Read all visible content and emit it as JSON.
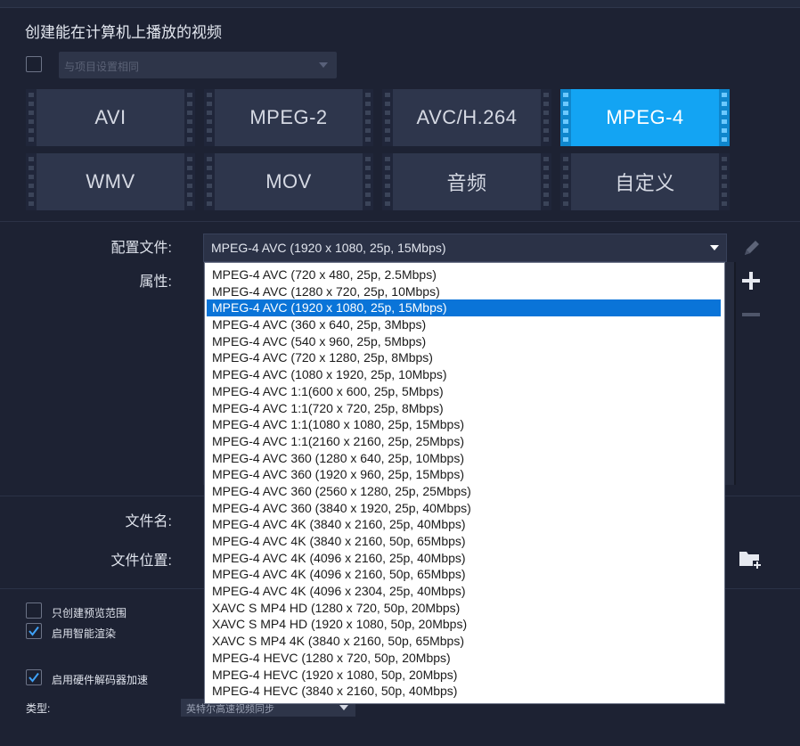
{
  "heading": "创建能在计算机上播放的视频",
  "project_select": {
    "value": "与项目设置相同",
    "checked": false
  },
  "formats": [
    {
      "label": "AVI",
      "active": false
    },
    {
      "label": "MPEG-2",
      "active": false
    },
    {
      "label": "AVC/H.264",
      "active": false
    },
    {
      "label": "MPEG-4",
      "active": true
    },
    {
      "label": "WMV",
      "active": false
    },
    {
      "label": "MOV",
      "active": false
    },
    {
      "label": "音频",
      "active": false
    },
    {
      "label": "自定义",
      "active": false
    }
  ],
  "profile": {
    "label": "配置文件:",
    "value": "MPEG-4 AVC (1920 x 1080, 25p, 15Mbps)",
    "properties_label": "属性:",
    "options": [
      "MPEG-4 AVC (720 x 480, 25p, 2.5Mbps)",
      "MPEG-4 AVC (1280 x 720, 25p, 10Mbps)",
      "MPEG-4 AVC (1920 x 1080, 25p, 15Mbps)",
      "MPEG-4 AVC (360 x 640, 25p, 3Mbps)",
      "MPEG-4 AVC (540 x 960, 25p, 5Mbps)",
      "MPEG-4 AVC (720 x 1280, 25p, 8Mbps)",
      "MPEG-4 AVC (1080 x 1920, 25p, 10Mbps)",
      "MPEG-4 AVC 1:1(600 x 600, 25p, 5Mbps)",
      "MPEG-4 AVC 1:1(720 x 720, 25p, 8Mbps)",
      "MPEG-4 AVC 1:1(1080 x 1080, 25p, 15Mbps)",
      "MPEG-4 AVC 1:1(2160 x 2160, 25p, 25Mbps)",
      "MPEG-4 AVC 360 (1280 x 640, 25p, 10Mbps)",
      "MPEG-4 AVC 360 (1920 x 960, 25p, 15Mbps)",
      "MPEG-4 AVC 360 (2560 x 1280, 25p, 25Mbps)",
      "MPEG-4 AVC 360 (3840 x 1920, 25p, 40Mbps)",
      "MPEG-4 AVC 4K (3840 x 2160, 25p, 40Mbps)",
      "MPEG-4 AVC 4K (3840 x 2160, 50p, 65Mbps)",
      "MPEG-4 AVC 4K (4096 x 2160, 25p, 40Mbps)",
      "MPEG-4 AVC 4K (4096 x 2160, 50p, 65Mbps)",
      "MPEG-4 AVC 4K (4096 x 2304, 25p, 40Mbps)",
      "XAVC S MP4 HD (1280 x 720, 50p, 20Mbps)",
      "XAVC S MP4 HD (1920 x 1080, 50p, 20Mbps)",
      "XAVC S MP4 4K (3840 x 2160, 50p, 65Mbps)",
      "MPEG-4 HEVC (1280 x 720, 50p, 20Mbps)",
      "MPEG-4 HEVC (1920 x 1080, 50p, 20Mbps)",
      "MPEG-4 HEVC (3840 x 2160, 50p, 40Mbps)"
    ],
    "selected_index": 2
  },
  "file": {
    "name_label": "文件名:",
    "location_label": "文件位置:"
  },
  "options": {
    "preview_range": {
      "label": "只创建预览范围",
      "checked": false
    },
    "smart_render": {
      "label": "启用智能渲染",
      "checked": true
    },
    "hw_decoder": {
      "label": "启用硬件解码器加速",
      "checked": true
    },
    "type_label": "类型:",
    "type_value": "英特尔高速视频同步"
  },
  "icons": {
    "edit": "pencil-icon",
    "add": "plus-icon",
    "remove": "minus-icon",
    "folder": "folder-add-icon",
    "check": "checkmark-icon"
  },
  "colors": {
    "background": "#1d2233",
    "tile": "#2e364c",
    "tile_active": "#13a4f3",
    "selection": "#0a74d8",
    "check": "#3fa2f7"
  }
}
